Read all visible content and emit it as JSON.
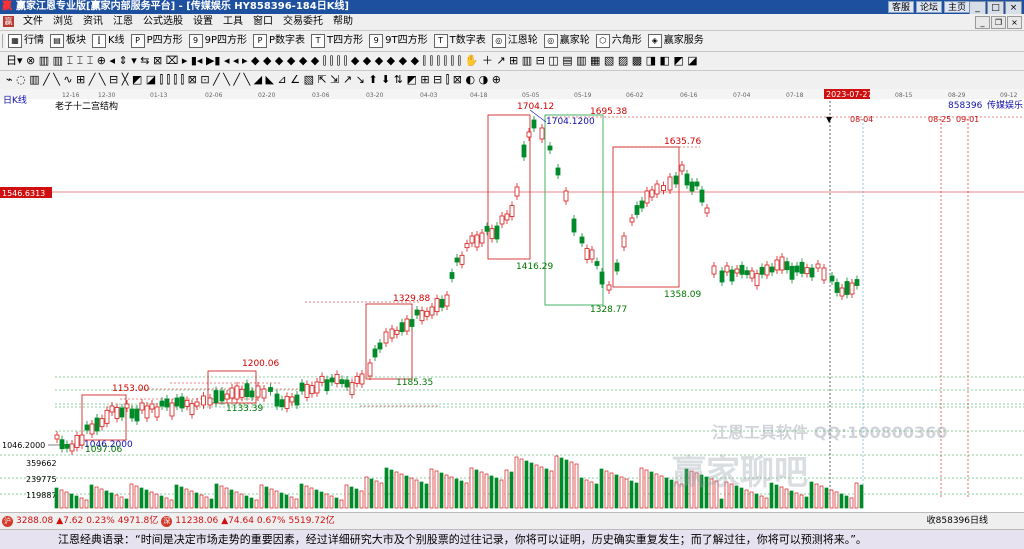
{
  "window": {
    "title": "赢家江恩专业版[赢家内部服务平台] - [传媒娱乐  HY858396-184日K线]",
    "links": [
      "客服",
      "论坛",
      "主页"
    ],
    "controls": [
      "_",
      "□",
      "×"
    ],
    "app_icon": "赢"
  },
  "menu": {
    "icon": "赢",
    "items": [
      "文件",
      "浏览",
      "资讯",
      "江恩",
      "公式选股",
      "设置",
      "工具",
      "窗口",
      "交易委托",
      "帮助"
    ],
    "window_controls": [
      "_",
      "❐",
      "×"
    ]
  },
  "toolbar1": {
    "items": [
      {
        "label": "行情",
        "icon": "quote-icon",
        "glyph": "▦"
      },
      {
        "label": "板块",
        "icon": "sector-icon",
        "glyph": "▤"
      },
      {
        "label": "K线",
        "icon": "kline-icon",
        "glyph": "⫿"
      },
      {
        "label": "P四方形",
        "icon": "p-square-icon",
        "glyph": "P"
      },
      {
        "label": "9P四方形",
        "icon": "9p-square-icon",
        "glyph": "9"
      },
      {
        "label": "P数字表",
        "icon": "p-table-icon",
        "glyph": "P"
      },
      {
        "label": "T四方形",
        "icon": "t-square-icon",
        "glyph": "T"
      },
      {
        "label": "9T四方形",
        "icon": "9t-square-icon",
        "glyph": "9"
      },
      {
        "label": "T数字表",
        "icon": "t-table-icon",
        "glyph": "T"
      },
      {
        "label": "江恩轮",
        "icon": "gann-wheel-icon",
        "glyph": "◎"
      },
      {
        "label": "赢家轮",
        "icon": "winner-wheel-icon",
        "glyph": "◎"
      },
      {
        "label": "六角形",
        "icon": "hexagon-icon",
        "glyph": "⬡"
      },
      {
        "label": "赢家服务",
        "icon": "service-icon",
        "glyph": "◈"
      }
    ]
  },
  "toolbar2": {
    "glyphs": "日▾ ⊗ ▥ ▥ ⌶ ⌶ ⌶ ⊕ ◂ ⇕ ▾ ⇆ ⊠ ⌧ ▸ ▮◂ ▶▮ ◂ ◂ ▸ ◆ ◆ ◆ ◆ ◆ ◆ ⫿ ⫿ ⫿ ⫿ ◆ ◆ ◆ ◆ ◆ ◆ ⫿ ⫿ ⫿ ⫿ ⫿ ⫿ ✋ ＋ ↗ ⊞ ▥ ⊟ ◫ ▤ ▥ ▦ ▧ ▨ ▩ ◨ ◧ ◩ ◪"
  },
  "toolbar3": {
    "glyphs": "⌁ ◌ ▥ ╱ ╲ ∿ ⊞ ╱ ╲ ⊟ ╳ ◩ ◪ ⫿ ⫿ ⫿ ⫿ ⊠ ⊡ ╱ ╲ ╱ ╲ ◢ ◣ ⊿ ∠ ▧ ⇱ ⇲ ↗ ↘ ⬆ ⬇ ⇅ ◩ ⊞ ⊟ ⫿ ⊠ ◐ ◑ ⊕"
  },
  "chart": {
    "period_label": "日K线",
    "structure_label": "老子十二宫结构",
    "code_label": "858396",
    "name_label": "传媒娱乐",
    "left_price_label": "1546.6313",
    "left_axis_label": "1046.2000",
    "volume_labels": [
      "359662",
      "239775",
      "119887"
    ],
    "highlight_date": "2023-07-27",
    "date_ticks": [
      "12-16",
      "12-30",
      "01-13",
      "02-06",
      "02-20",
      "03-06",
      "03-20",
      "04-03",
      "04-18",
      "05-05",
      "05-19",
      "06-02",
      "06-16",
      "07-04",
      "07-18",
      "2023-07-27",
      "08-15",
      "08-29",
      "09-12"
    ],
    "price_labels": [
      {
        "text": "1704.12",
        "color": "#d00000"
      },
      {
        "text": "1704.1200",
        "color": "#1010b0"
      },
      {
        "text": "1695.38",
        "color": "#d00000"
      },
      {
        "text": "1635.76",
        "color": "#d00000"
      },
      {
        "text": "1416.29",
        "color": "#007700"
      },
      {
        "text": "1358.09",
        "color": "#007700"
      },
      {
        "text": "1328.77",
        "color": "#007700"
      },
      {
        "text": "1329.88",
        "color": "#d00000"
      },
      {
        "text": "1185.35",
        "color": "#007700"
      },
      {
        "text": "1200.06",
        "color": "#d00000"
      },
      {
        "text": "1133.39",
        "color": "#007700"
      },
      {
        "text": "1153.00",
        "color": "#d00000"
      },
      {
        "text": "1046.2000",
        "color": "#1010b0"
      },
      {
        "text": "1097.06",
        "color": "#007700"
      }
    ],
    "future_labels": [
      "08-04",
      "08-25",
      "09-01"
    ],
    "watermark1": "江恩工具软件  QQ:100800360",
    "watermark2": "赢家聊吧",
    "colors": {
      "up": "#d81818",
      "down": "#008b2a",
      "bg": "#ffffff"
    }
  },
  "statusbar": {
    "left1_name": "3288.08",
    "left1_change": "▲7.62",
    "left1_pct": "0.23%",
    "left1_amt": "4971.8亿",
    "left2_name": "11238.06",
    "left2_change": "▲74.64",
    "left2_pct": "0.67%",
    "left2_amt": "5519.72亿",
    "right": "收858396日线"
  },
  "quote": {
    "text": "江恩经典语录：“时间是决定市场走势的重要因素，经过详细研究大市及个别股票的过往记录，你将可以证明，历史确实重复发生；而了解过往，你将可以预测将来。”。"
  }
}
